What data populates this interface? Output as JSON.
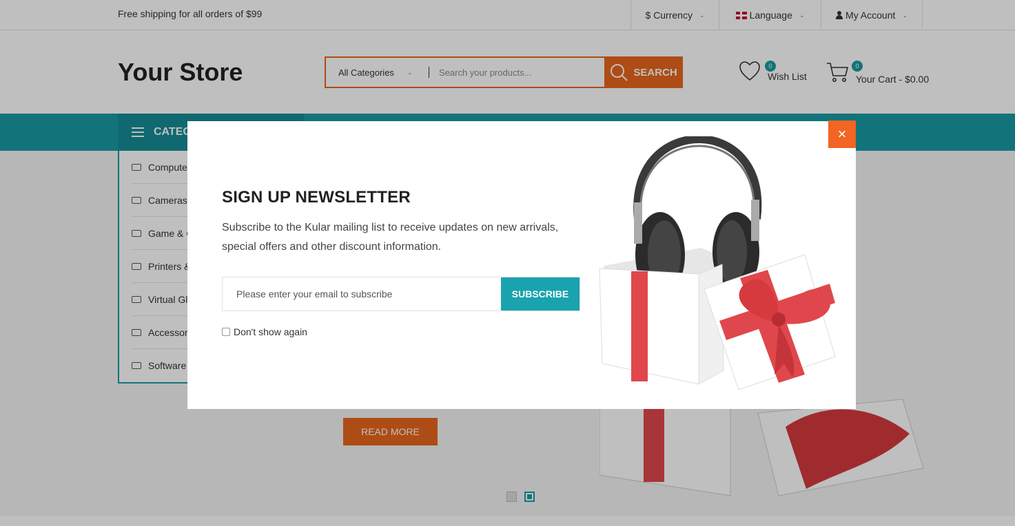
{
  "topbar": {
    "promo": "Free shipping for all orders of $99",
    "currency": "$ Currency",
    "language": "Language",
    "account": "My Account"
  },
  "header": {
    "logo": "Your Store",
    "search_category": "All Categories",
    "search_placeholder": "Search your products...",
    "search_button": "SEARCH",
    "wishlist_label": "Wish List",
    "wishlist_count": "0",
    "cart_label": "Your Cart - $0.00",
    "cart_count": "0"
  },
  "nav": {
    "categories_title": "CATEG",
    "items": [
      {
        "label": "Compute",
        "icon": "laptop-icon"
      },
      {
        "label": "Cameras",
        "icon": "camera-icon"
      },
      {
        "label": "Game & C",
        "icon": "gamepad-icon"
      },
      {
        "label": "Printers &",
        "icon": "printer-icon"
      },
      {
        "label": "Virtual Gl",
        "icon": "vr-glasses-icon"
      },
      {
        "label": "Accessor",
        "icon": "microphone-icon"
      },
      {
        "label": "Software",
        "icon": "software-icon"
      }
    ]
  },
  "hero": {
    "read_more": "READ MORE"
  },
  "modal": {
    "title": "SIGN UP NEWSLETTER",
    "description": "Subscribe to the Kular mailing list to receive updates on new arrivals, special offers and other discount information.",
    "email_placeholder": "Please enter your email to subscribe",
    "subscribe_button": "SUBSCRIBE",
    "dont_show": "Don't show again",
    "close": "×"
  },
  "colors": {
    "accent_orange": "#e8661d",
    "accent_teal": "#1a9aa5",
    "close_orange": "#f26522"
  }
}
